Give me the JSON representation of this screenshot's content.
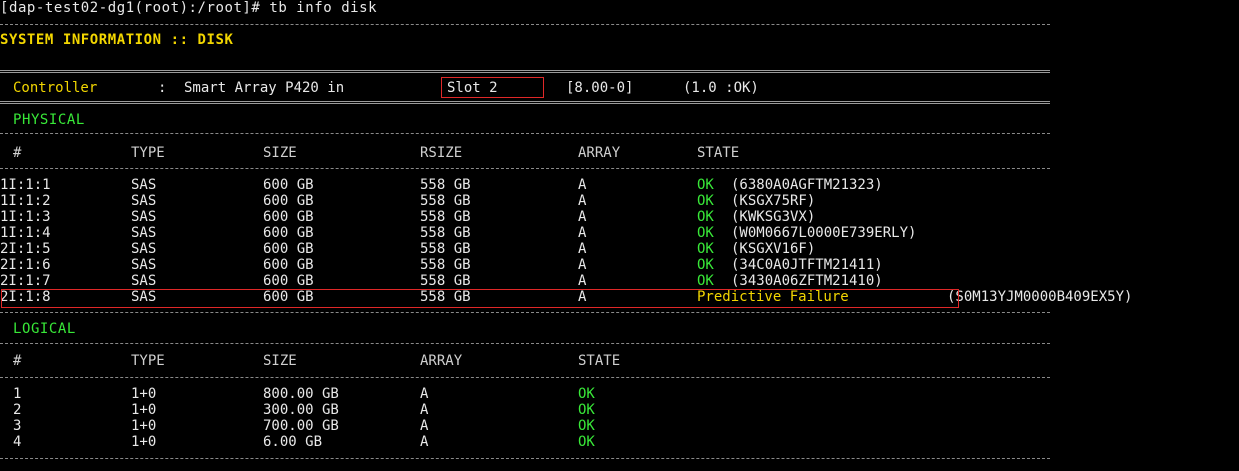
{
  "prompt": "[dap-test02-dg1(root):/root]# tb info disk",
  "title": "SYSTEM INFORMATION :: DISK",
  "controller": {
    "label": "Controller",
    "separator": ":",
    "model": "Smart Array P420 in",
    "slot": "Slot 2",
    "firmware": "[8.00-0]",
    "status": "(1.0 :OK)"
  },
  "physical": {
    "heading": "PHYSICAL",
    "columns": [
      "#",
      "TYPE",
      "SIZE",
      "RSIZE",
      "ARRAY",
      "STATE"
    ],
    "rows": [
      {
        "id": "1I:1:1",
        "type": "SAS",
        "size": "600 GB",
        "rsize": "558 GB",
        "array": "A",
        "state": "OK",
        "serial": "(6380A0AGFTM21323)"
      },
      {
        "id": "1I:1:2",
        "type": "SAS",
        "size": "600 GB",
        "rsize": "558 GB",
        "array": "A",
        "state": "OK",
        "serial": "(KSGX75RF)"
      },
      {
        "id": "1I:1:3",
        "type": "SAS",
        "size": "600 GB",
        "rsize": "558 GB",
        "array": "A",
        "state": "OK",
        "serial": "(KWKSG3VX)"
      },
      {
        "id": "1I:1:4",
        "type": "SAS",
        "size": "600 GB",
        "rsize": "558 GB",
        "array": "A",
        "state": "OK",
        "serial": "(W0M0667L0000E739ERLY)"
      },
      {
        "id": "2I:1:5",
        "type": "SAS",
        "size": "600 GB",
        "rsize": "558 GB",
        "array": "A",
        "state": "OK",
        "serial": "(KSGXV16F)"
      },
      {
        "id": "2I:1:6",
        "type": "SAS",
        "size": "600 GB",
        "rsize": "558 GB",
        "array": "A",
        "state": "OK",
        "serial": "(34C0A0JTFTM21411)"
      },
      {
        "id": "2I:1:7",
        "type": "SAS",
        "size": "600 GB",
        "rsize": "558 GB",
        "array": "A",
        "state": "OK",
        "serial": "(3430A06ZFTM21410)"
      },
      {
        "id": "2I:1:8",
        "type": "SAS",
        "size": "600 GB",
        "rsize": "558 GB",
        "array": "A",
        "state": "Predictive Failure",
        "serial": "(S0M13YJM0000B409EX5Y)"
      }
    ]
  },
  "logical": {
    "heading": "LOGICAL",
    "columns": [
      "#",
      "TYPE",
      "SIZE",
      "ARRAY",
      "STATE"
    ],
    "rows": [
      {
        "id": "1",
        "type": "1+0",
        "size": "800.00 GB",
        "array": "A",
        "state": "OK"
      },
      {
        "id": "2",
        "type": "1+0",
        "size": "300.00 GB",
        "array": "A",
        "state": "OK"
      },
      {
        "id": "3",
        "type": "1+0",
        "size": "700.00 GB",
        "array": "A",
        "state": "OK"
      },
      {
        "id": "4",
        "type": "1+0",
        "size": "6.00 GB",
        "array": "A",
        "state": "OK"
      }
    ]
  },
  "colors": {
    "background": "#000000",
    "text": "#e8e8e8",
    "heading": "#f2d600",
    "ok": "#38e838",
    "failure": "#f2d600",
    "highlight_box": "#e02828"
  }
}
